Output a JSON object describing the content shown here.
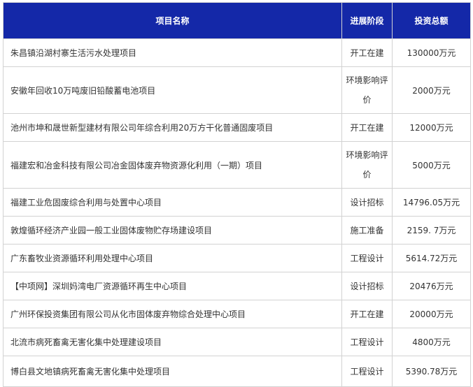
{
  "table": {
    "headers": {
      "name": "项目名称",
      "stage": "进展阶段",
      "amount": "投资总额"
    },
    "rows": [
      {
        "name": "朱昌镇沿湖村寨生活污水处理项目",
        "stage": "开工在建",
        "amount": "130000万元"
      },
      {
        "name": "安徽年回收10万吨废旧铅酸蓄电池项目",
        "stage": "环境影响评价",
        "amount": "2000万元"
      },
      {
        "name": "池州市坤和晟世新型建材有限公司年综合利用20万方干化普通固废项目",
        "stage": "开工在建",
        "amount": "12000万元"
      },
      {
        "name": "福建宏和冶金科技有限公司冶金固体废弃物资源化利用（一期）项目",
        "stage": "环境影响评价",
        "amount": "5000万元"
      },
      {
        "name": "福建工业危固废综合利用与处置中心项目",
        "stage": "设计招标",
        "amount": "14796.05万元"
      },
      {
        "name": "敦煌循环经济产业园一般工业固体废物贮存场建设项目",
        "stage": "施工准备",
        "amount": "2159. 7万元"
      },
      {
        "name": "广东畜牧业资源循环利用处理中心项目",
        "stage": "工程设计",
        "amount": "5614.72万元"
      },
      {
        "name": "【中项网】深圳妈湾电厂资源循环再生中心项目",
        "stage": "设计招标",
        "amount": "20476万元"
      },
      {
        "name": "广州环保投资集团有限公司从化市固体废弃物综合处理中心项目",
        "stage": "开工在建",
        "amount": "20000万元"
      },
      {
        "name": "北流市病死畜禽无害化集中处理建设项目",
        "stage": "工程设计",
        "amount": "4800万元"
      },
      {
        "name": "博白县文地镇病死畜禽无害化集中处理项目",
        "stage": "工程设计",
        "amount": "5390.78万元"
      }
    ]
  }
}
